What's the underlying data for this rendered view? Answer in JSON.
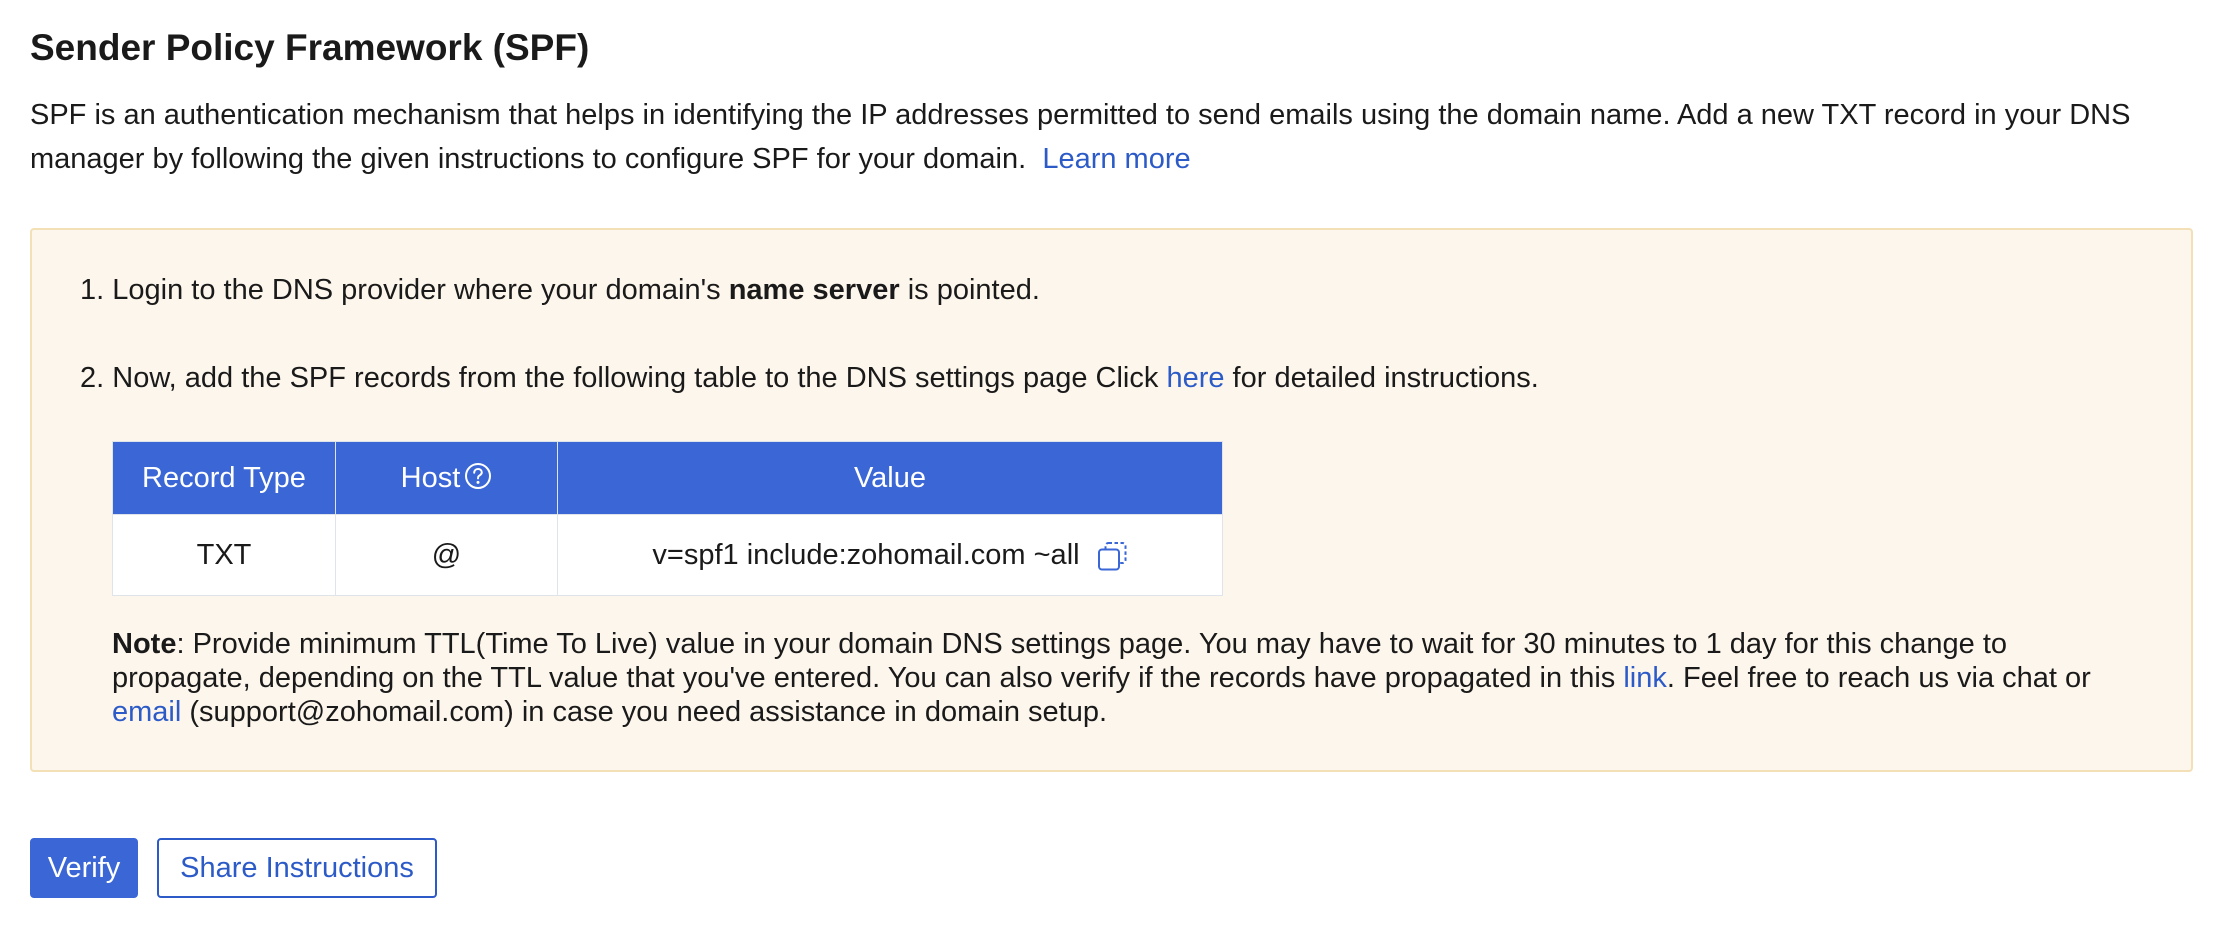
{
  "header": {
    "title": "Sender Policy Framework (SPF)"
  },
  "intro": {
    "text": "SPF is an authentication mechanism that helps in identifying the IP addresses permitted to send emails using the domain name. Add a new TXT record in your DNS manager by following the given instructions to configure SPF for your domain.",
    "learn_more": "Learn more"
  },
  "steps": [
    {
      "number": "1.",
      "text_before": "Login to the DNS provider where your domain's",
      "bold": "name server",
      "text_after": "is pointed."
    },
    {
      "number": "2.",
      "text_before": "Now, add the SPF records from the following table to the DNS settings page Click",
      "link": "here",
      "text_after": "for detailed instructions."
    }
  ],
  "table": {
    "headers": {
      "record_type": "Record Type",
      "host": "Host",
      "value": "Value"
    },
    "rows": [
      {
        "record_type": "TXT",
        "host": "@",
        "value": "v=spf1 include:zohomail.com ~all"
      }
    ]
  },
  "note": {
    "label": "Note",
    "text1": ": Provide minimum TTL(Time To Live) value in your domain DNS settings page. You may have to wait for 30 minutes to 1 day for this change to propagate, depending on the TTL value that you've entered. You can also verify if the records have propagated in this",
    "link": "link",
    "text2": ". Feel free to reach us via chat or",
    "email_link": "email",
    "text3": "(support@zohomail.com) in case you need assistance in domain setup."
  },
  "actions": {
    "verify": "Verify",
    "share": "Share Instructions"
  },
  "colors": {
    "primary": "#3a66d6",
    "link": "#2c5bc8",
    "info_bg": "#fdf6ec",
    "info_border": "#f4e0b7"
  },
  "icons": {
    "host_help": "question-circle-icon",
    "copy": "copy-icon"
  }
}
